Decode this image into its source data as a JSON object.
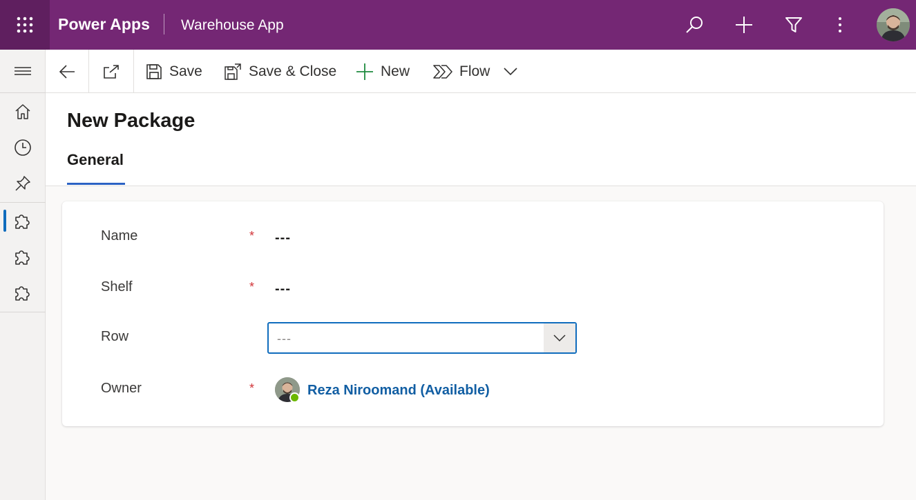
{
  "header": {
    "brand": "Power Apps",
    "app_name": "Warehouse App",
    "icons": [
      "waffle-icon",
      "search-icon",
      "add-icon",
      "filter-icon",
      "more-icon"
    ]
  },
  "commands": {
    "save": "Save",
    "save_close": "Save & Close",
    "new": "New",
    "flow": "Flow"
  },
  "page": {
    "title": "New Package",
    "tab": "General"
  },
  "form": {
    "name": {
      "label": "Name",
      "required": "*",
      "value": "---"
    },
    "shelf": {
      "label": "Shelf",
      "required": "*",
      "value": "---"
    },
    "row": {
      "label": "Row",
      "value": "---"
    },
    "owner": {
      "label": "Owner",
      "required": "*",
      "value": "Reza Niroomand (Available)"
    }
  },
  "colors": {
    "header": "#742774",
    "accent": "#0f6cbd",
    "link": "#115ea3",
    "required": "#d13438",
    "presence": "#6bb700"
  }
}
